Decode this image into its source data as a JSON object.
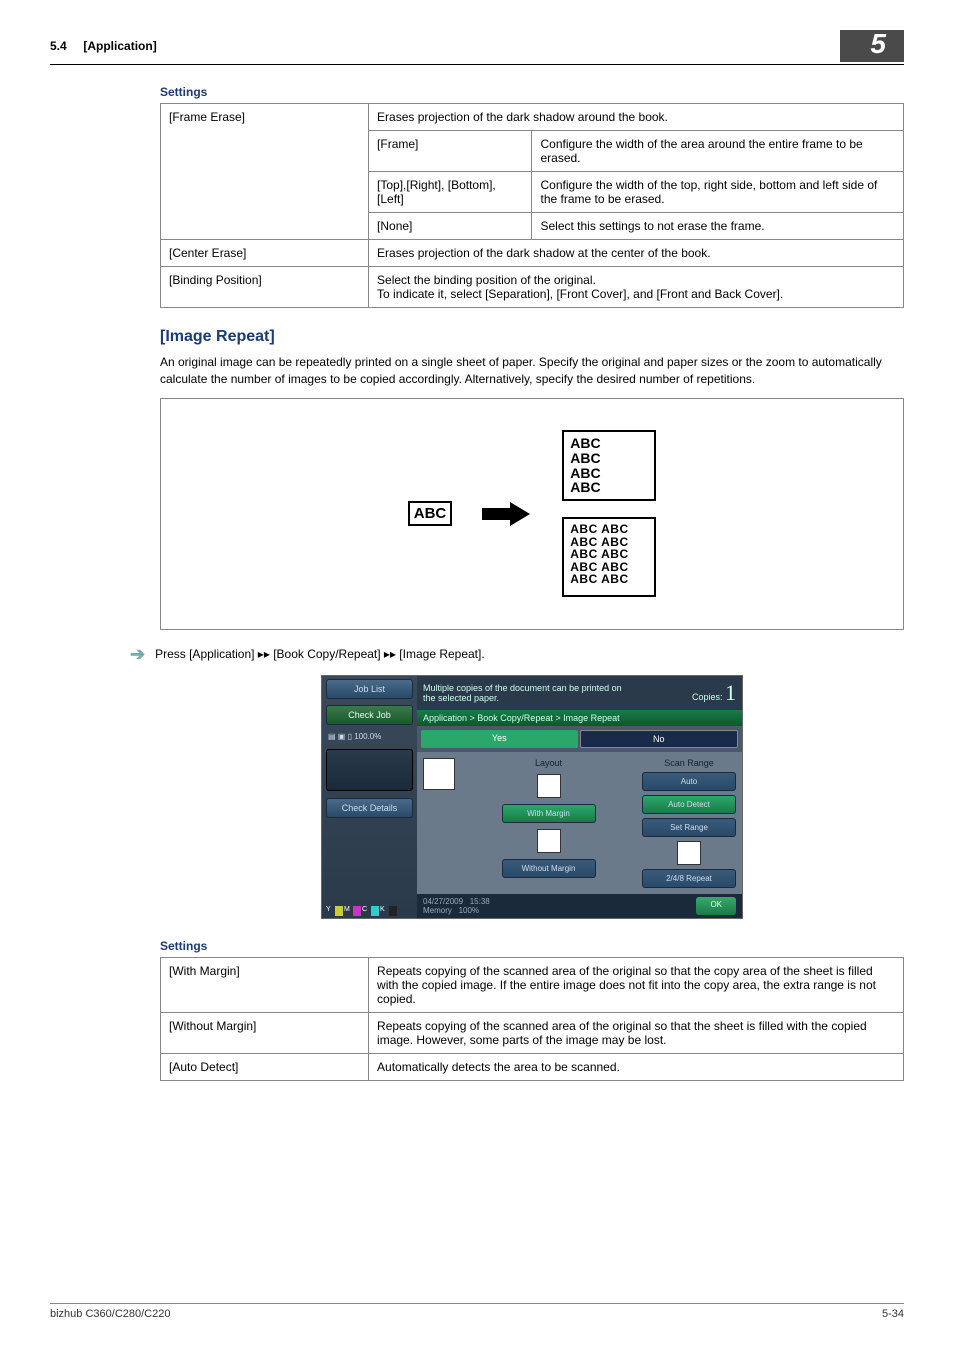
{
  "header": {
    "section_num": "5.4",
    "section_title": "[Application]",
    "chapter_num": "5"
  },
  "settings1": {
    "title": "Settings",
    "rows": {
      "frame_erase": {
        "label": "[Frame Erase]",
        "desc": "Erases projection of the dark shadow around the book.",
        "sub": {
          "frame": {
            "label": "[Frame]",
            "desc": "Configure the width of the area around the entire frame to be erased."
          },
          "trbl": {
            "label": "[Top],[Right], [Bottom], [Left]",
            "desc": "Configure the width of the top, right side, bottom and left side of the frame to be erased."
          },
          "none": {
            "label": "[None]",
            "desc": "Select this settings to not erase the frame."
          }
        }
      },
      "center_erase": {
        "label": "[Center Erase]",
        "desc": "Erases projection of the dark shadow at the center of the book."
      },
      "binding": {
        "label": "[Binding Position]",
        "desc": "Select the binding position of the original.\nTo indicate it, select [Separation], [Front Cover], and [Front and Back Cover]."
      }
    }
  },
  "image_repeat": {
    "title": "[Image Repeat]",
    "desc": "An original image can be repeatedly printed on a single sheet of paper. Specify the original and paper sizes or the zoom to automatically calculate the number of images to be copied accordingly. Alternatively, specify the desired number of repetitions.",
    "abc": "ABC",
    "step": "Press [Application] ▸▸ [Book Copy/Repeat] ▸▸ [Image Repeat]."
  },
  "ui": {
    "job_list": "Job List",
    "check_job": "Check Job",
    "check_details": "Check Details",
    "top_text": "Multiple copies of the document can be printed on the selected paper.",
    "copies_label": "Copies:",
    "copies_value": "1",
    "crumb": "Application > Book Copy/Repeat > Image Repeat",
    "yes": "Yes",
    "no": "No",
    "layout": "Layout",
    "with_margin": "With Margin",
    "without_margin": "Without Margin",
    "scan_range": "Scan Range",
    "auto": "Auto",
    "auto_detect": "Auto Detect",
    "set_range": "Set Range",
    "repeat248": "2/4/8 Repeat",
    "date": "04/27/2009",
    "time": "15:38",
    "memory": "Memory",
    "mem_pct": "100%",
    "ok": "OK",
    "toner_pct": "100.0%"
  },
  "settings2": {
    "title": "Settings",
    "rows": {
      "with_margin": {
        "label": "[With Margin]",
        "desc": "Repeats copying of the scanned area of the original so that the copy area of the sheet is filled with the copied image. If the entire image does not fit into the copy area, the extra range is not copied."
      },
      "without_margin": {
        "label": "[Without Margin]",
        "desc": "Repeats copying of the scanned area of the original so that the sheet is filled with the copied image. However, some parts of the image may be lost."
      },
      "auto_detect": {
        "label": "[Auto Detect]",
        "desc": "Automatically detects the area to be scanned."
      }
    }
  },
  "footer": {
    "model": "bizhub C360/C280/C220",
    "page": "5-34"
  }
}
